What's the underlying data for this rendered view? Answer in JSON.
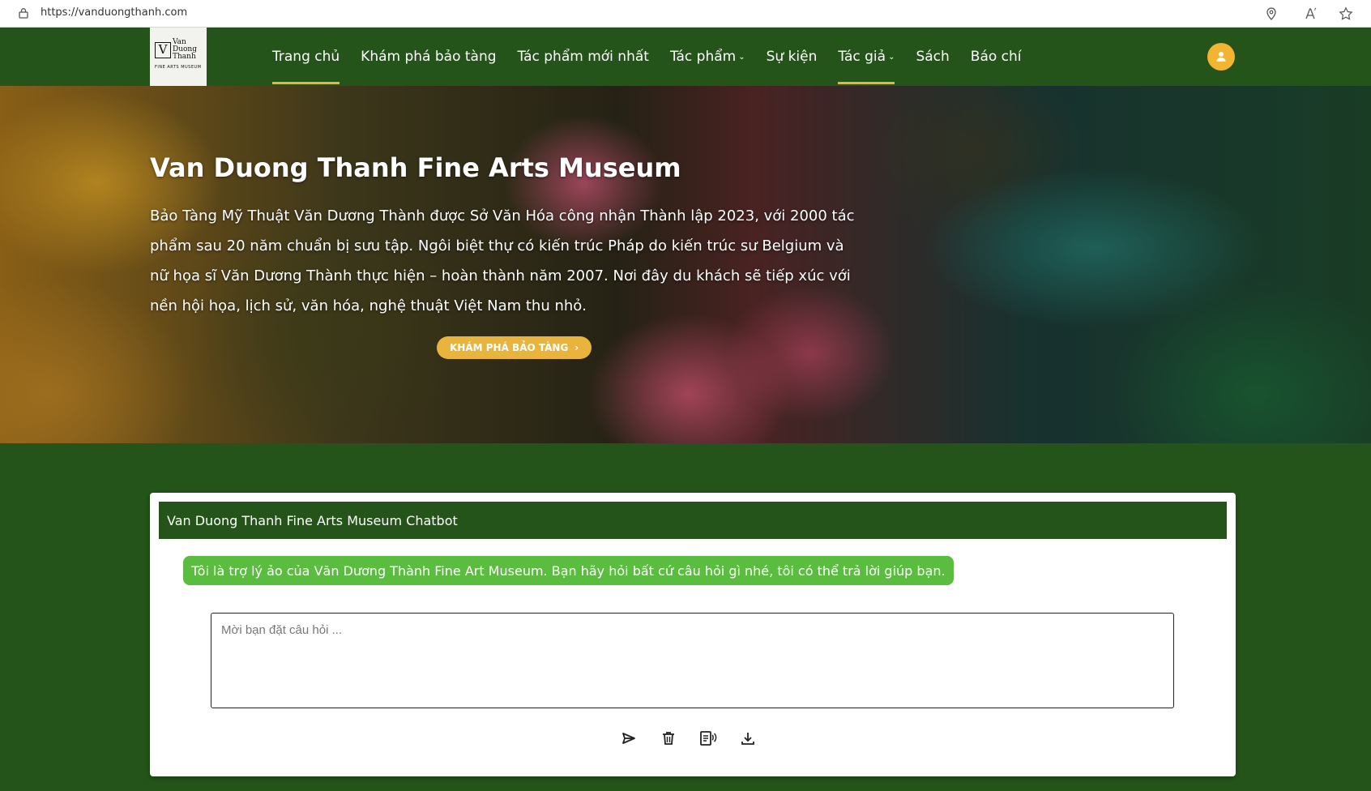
{
  "browser": {
    "url": "https://vanduongthanh.com",
    "icons": [
      "lock-icon",
      "location-icon",
      "read-aloud-icon",
      "favorite-star-icon"
    ]
  },
  "header": {
    "logo": {
      "letter": "V",
      "words": [
        "Van",
        "Duong",
        "Thanh"
      ],
      "subtitle": "FINE ARTS MUSEUM"
    },
    "nav": [
      {
        "label": "Trang chủ",
        "active": true
      },
      {
        "label": "Khám phá bảo tàng"
      },
      {
        "label": "Tác phẩm mới nhất"
      },
      {
        "label": "Tác phẩm",
        "dropdown": true
      },
      {
        "label": "Sự kiện"
      },
      {
        "label": "Tác giả",
        "dropdown": true,
        "active": true
      },
      {
        "label": "Sách"
      },
      {
        "label": "Báo chí"
      }
    ],
    "user_icon": "user-icon"
  },
  "hero": {
    "title": "Van Duong Thanh Fine Arts Museum",
    "description": "Bảo Tàng Mỹ Thuật Văn Dương Thành được Sở Văn Hóa công nhận Thành lập 2023, với 2000 tác phẩm sau 20 năm chuẩn bị sưu tập. Ngôi biệt thự có kiến trúc Pháp do kiến trúc sư Belgium và nữ họa sĩ Văn Dương Thành thực hiện – hoàn thành năm 2007. Nơi đây du khách sẽ tiếp xúc với nền hội họa, lịch sử, văn hóa, nghệ thuật Việt Nam thu nhỏ.",
    "button_label": "KHÁM PHÁ BẢO TÀNG",
    "button_icon": "chevron-right-icon"
  },
  "chatbot": {
    "title": "Van Duong Thanh Fine Arts Museum Chatbot",
    "greeting": "Tôi là trợ lý ảo của Văn Dương Thành Fine Art Museum. Bạn hãy hỏi bất cứ câu hỏi gì nhé, tôi có thể trả lời giúp bạn.",
    "input_placeholder": "Mời bạn đặt câu hỏi ...",
    "input_value": "",
    "tools": [
      "send-icon",
      "trash-icon",
      "speech-icon",
      "download-icon"
    ]
  },
  "colors": {
    "brand_green": "#245419",
    "accent_gold": "#e9b43b",
    "bubble_green": "#5bbd3f"
  }
}
